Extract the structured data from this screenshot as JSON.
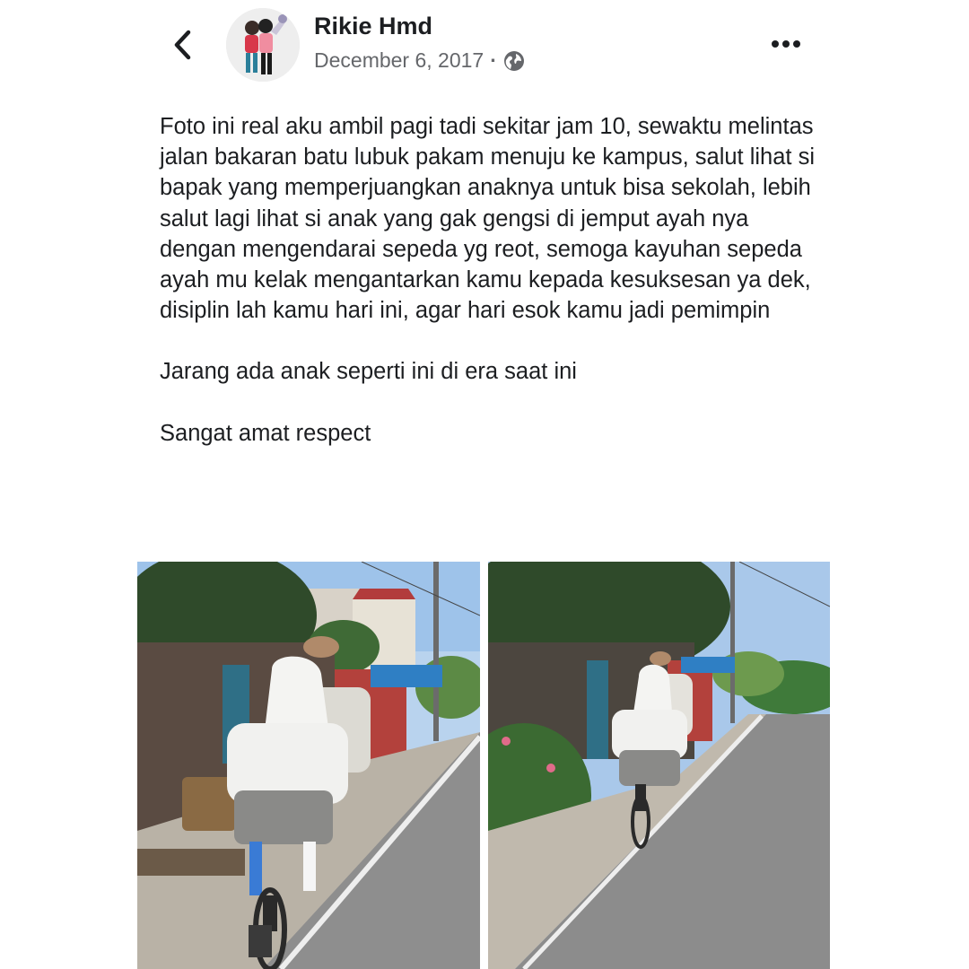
{
  "header": {
    "author_name": "Rikie Hmd",
    "date": "December 6, 2017",
    "separator": "·",
    "back_icon": "chevron-left-icon",
    "privacy_icon": "globe-icon",
    "more_icon": "more-horizontal-icon"
  },
  "post": {
    "paragraphs": [
      "Foto ini real aku ambil pagi tadi sekitar jam 10, sewaktu melintas jalan bakaran batu lubuk pakam menuju ke kampus, salut lihat si bapak yang memperjuangkan anaknya untuk bisa sekolah, lebih salut lagi lihat si anak yang gak gengsi di jemput ayah nya dengan mengendarai sepeda yg reot, semoga kayuhan sepeda ayah mu kelak mengantarkan kamu kepada kesuksesan ya dek, disiplin lah kamu hari ini, agar hari esok kamu jadi pemimpin",
      "Jarang ada anak seperti ini di era saat ini",
      "Sangat amat respect"
    ]
  },
  "photos": {
    "count": 2
  },
  "colors": {
    "text": "#1c1e21",
    "secondary_text": "#65676b",
    "background": "#ffffff"
  }
}
